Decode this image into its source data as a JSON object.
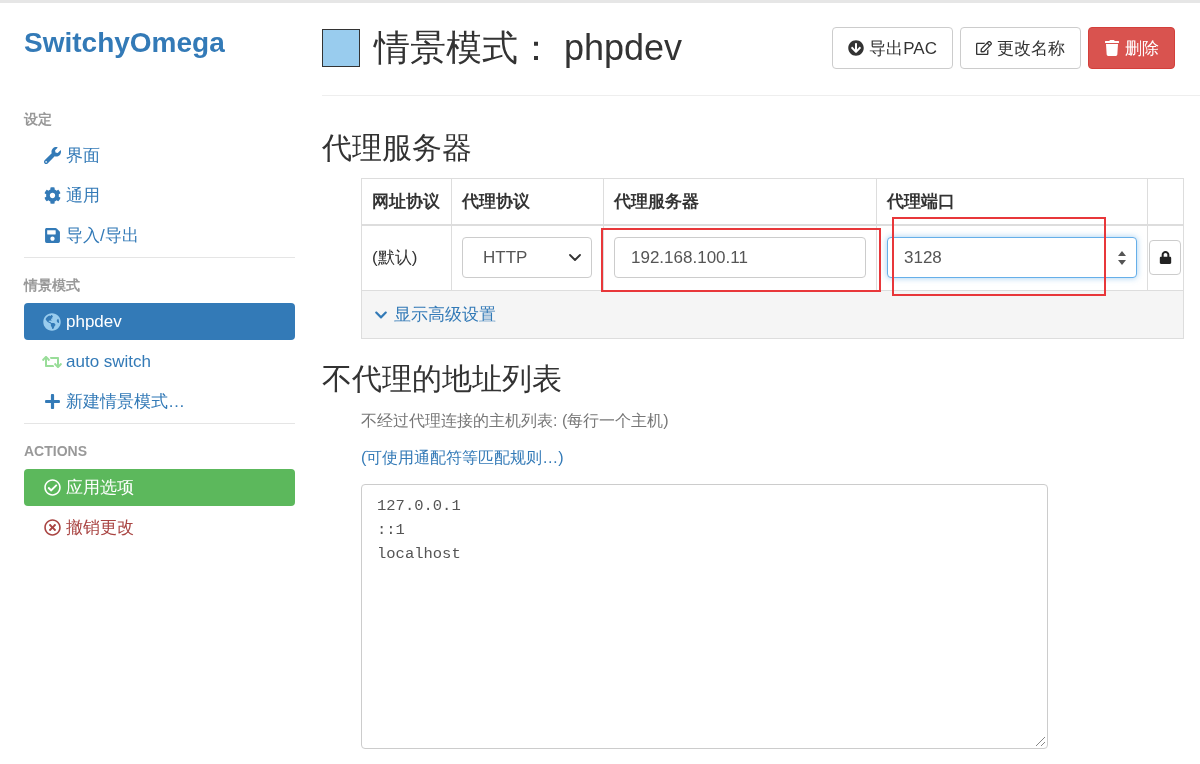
{
  "sidebar": {
    "brand": "SwitchyOmega",
    "sections": [
      {
        "heading": "设定",
        "items": [
          {
            "label": "界面",
            "selected": false
          },
          {
            "label": "通用",
            "selected": false
          },
          {
            "label": "导入/导出",
            "selected": false
          }
        ]
      },
      {
        "heading": "情景模式",
        "items": [
          {
            "label": "phpdev",
            "kind": "proxy",
            "color": "#99ccee",
            "selected": true
          },
          {
            "label": "auto switch",
            "kind": "switch",
            "color": "#99dd99",
            "selected": false
          },
          {
            "label": "新建情景模式…",
            "kind": "add",
            "selected": false
          }
        ]
      },
      {
        "heading": "ACTIONS",
        "items": [
          {
            "label": "应用选项",
            "kind": "apply"
          },
          {
            "label": "撤销更改",
            "kind": "discard"
          }
        ]
      }
    ]
  },
  "header": {
    "title": "情景模式： phpdev",
    "buttons": [
      {
        "label": "导出PAC",
        "kind": "default"
      },
      {
        "label": "更改名称",
        "kind": "default"
      },
      {
        "label": "删除",
        "kind": "danger"
      }
    ]
  },
  "proxy": {
    "heading": "代理服务器",
    "columns": [
      "网址协议",
      "代理协议",
      "代理服务器",
      "代理端口"
    ],
    "rows": [
      {
        "scheme": "(默认)",
        "protocol": "HTTP",
        "server": {
          "value": "192.168.100.11",
          "highlighted": true
        },
        "port": {
          "value": "3128",
          "highlighted": true,
          "focused": true
        }
      }
    ],
    "advanced_toggle": "显示高级设置"
  },
  "bypass": {
    "heading": "不代理的地址列表",
    "description": "不经过代理连接的主机列表: (每行一个主机)",
    "rules_link": "(可使用通配符等匹配规则…)",
    "entries": [
      "127.0.0.1",
      "::1",
      "localhost"
    ]
  }
}
